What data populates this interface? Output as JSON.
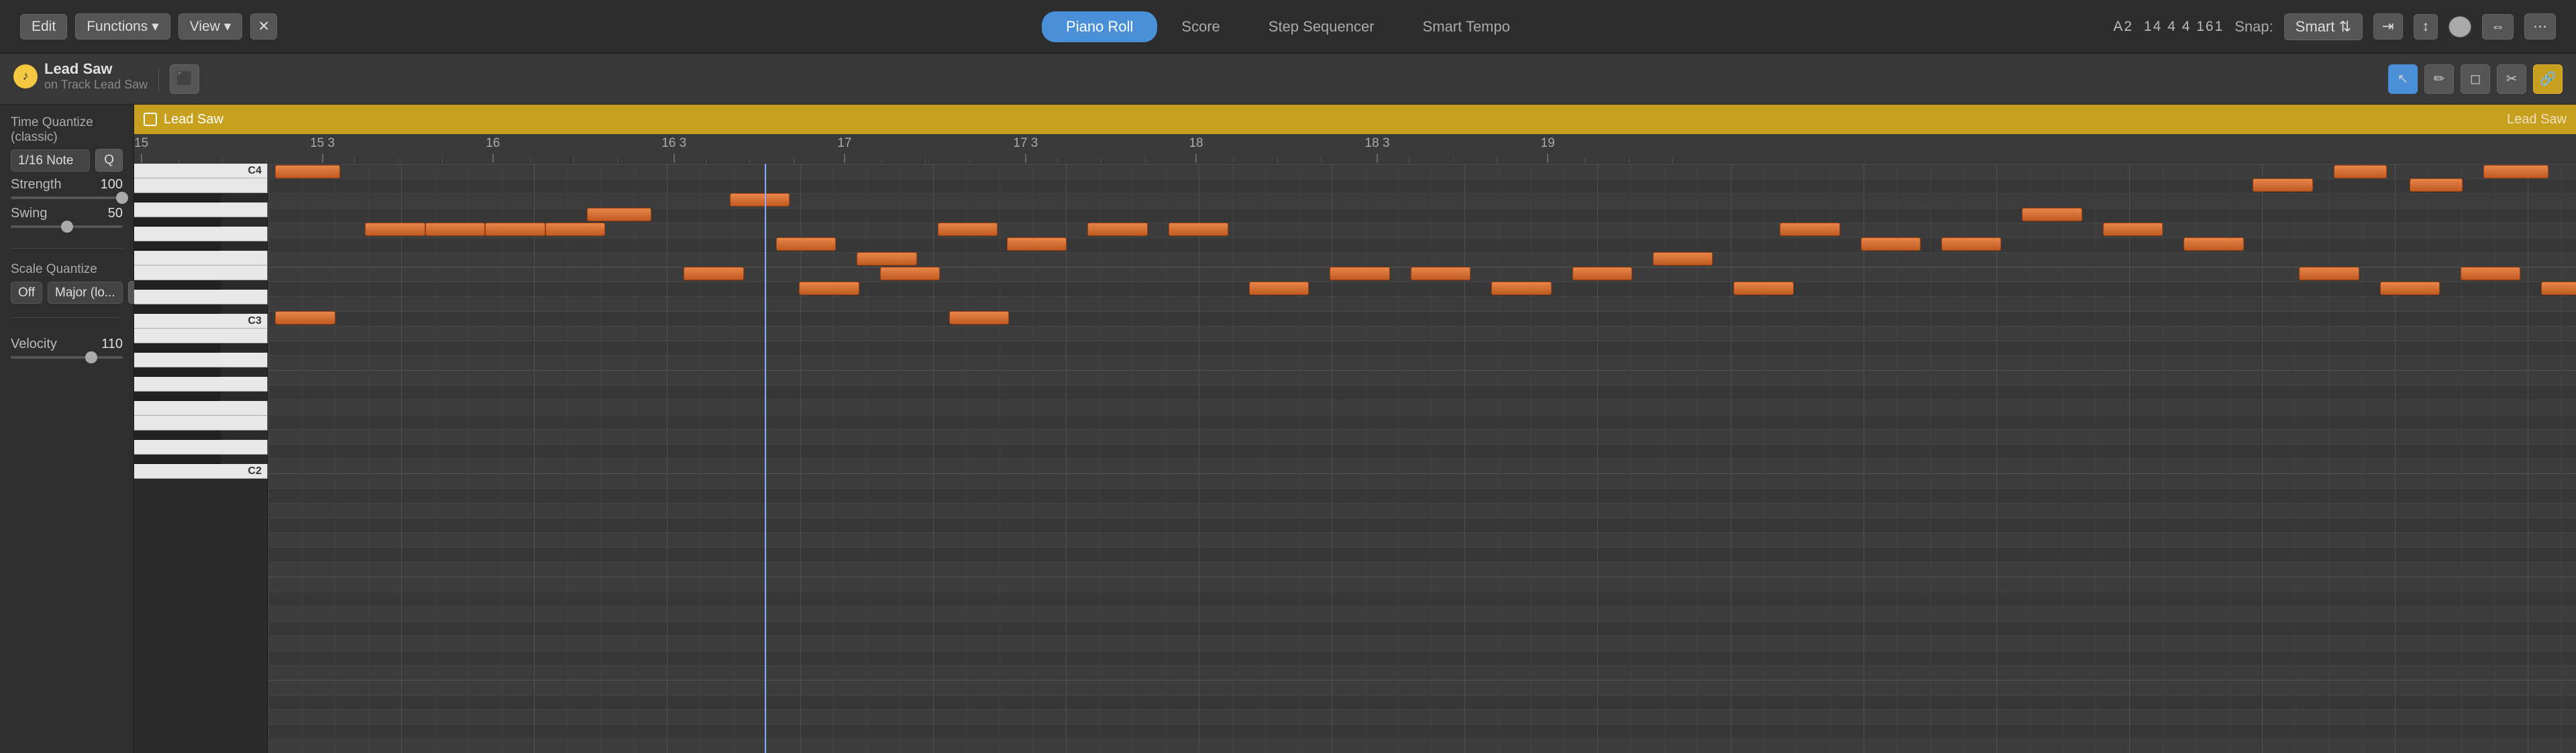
{
  "tabs": {
    "piano_roll": "Piano Roll",
    "score": "Score",
    "step_sequencer": "Step Sequencer",
    "smart_tempo": "Smart Tempo"
  },
  "top_bar": {
    "edit_label": "Edit",
    "functions_label": "Functions",
    "view_label": "View",
    "position": "A2",
    "time_sig": "14 4 4 161",
    "snap_label": "Snap:",
    "snap_value": "Smart"
  },
  "toolbar": {
    "tools": [
      "pencil",
      "cycle",
      "record",
      "trim",
      "link"
    ]
  },
  "track": {
    "name": "Lead Saw",
    "sub": "on Track Lead Saw"
  },
  "time_quantize": {
    "label": "Time Quantize (classic)",
    "note_value": "1/16 Note",
    "strength_label": "Strength",
    "strength_value": "100",
    "strength_pct": 100,
    "swing_label": "Swing",
    "swing_value": "50",
    "swing_pct": 50
  },
  "scale_quantize": {
    "label": "Scale Quantize",
    "off_label": "Off",
    "scale_label": "Major (lo...",
    "q_label": "Q"
  },
  "velocity": {
    "label": "Velocity",
    "value": "110",
    "pct": 72
  },
  "ruler": {
    "marks": [
      {
        "label": "15",
        "pos_pct": 0
      },
      {
        "label": "15 3",
        "pos_pct": 7.2
      },
      {
        "label": "16",
        "pos_pct": 14.4
      },
      {
        "label": "16 3",
        "pos_pct": 21.6
      },
      {
        "label": "17",
        "pos_pct": 28.8
      },
      {
        "label": "17 3",
        "pos_pct": 36
      },
      {
        "label": "18",
        "pos_pct": 43.2
      },
      {
        "label": "18 3",
        "pos_pct": 50.4
      },
      {
        "label": "19",
        "pos_pct": 57.6
      }
    ]
  },
  "region_label": "Lead Saw",
  "notes": [
    {
      "row": 14,
      "left_pct": 0.5,
      "width_pct": 3.2
    },
    {
      "row": 16,
      "left_pct": 4.5,
      "width_pct": 2.8
    },
    {
      "row": 16,
      "left_pct": 7.2,
      "width_pct": 2.8
    },
    {
      "row": 16,
      "left_pct": 9.8,
      "width_pct": 2.8
    },
    {
      "row": 16,
      "left_pct": 12.4,
      "width_pct": 2.8
    },
    {
      "row": 14,
      "left_pct": 14.2,
      "width_pct": 3.0
    },
    {
      "row": 15,
      "left_pct": 18.0,
      "width_pct": 2.8
    },
    {
      "row": 16,
      "left_pct": 21.5,
      "width_pct": 2.8
    },
    {
      "row": 15,
      "left_pct": 25.2,
      "width_pct": 2.8
    },
    {
      "row": 19,
      "left_pct": 9.5,
      "width_pct": 2.5
    },
    {
      "row": 14,
      "left_pct": 28.8,
      "width_pct": 2.8
    },
    {
      "row": 16,
      "left_pct": 32.5,
      "width_pct": 2.8
    },
    {
      "row": 15,
      "left_pct": 36.2,
      "width_pct": 2.8
    },
    {
      "row": 16,
      "left_pct": 39.8,
      "width_pct": 2.8
    },
    {
      "row": 14,
      "left_pct": 43.5,
      "width_pct": 2.8
    },
    {
      "row": 16,
      "left_pct": 47.2,
      "width_pct": 2.8
    },
    {
      "row": 15,
      "left_pct": 50.8,
      "width_pct": 2.8
    },
    {
      "row": 19,
      "left_pct": 43.0,
      "width_pct": 2.5
    },
    {
      "row": 22,
      "left_pct": 50.0,
      "width_pct": 2.5
    },
    {
      "row": 21,
      "left_pct": 55.5,
      "width_pct": 2.8
    },
    {
      "row": 19,
      "left_pct": 59.0,
      "width_pct": 2.5
    },
    {
      "row": 19,
      "left_pct": 62.5,
      "width_pct": 2.8
    },
    {
      "row": 22,
      "left_pct": 65.5,
      "width_pct": 2.5
    },
    {
      "row": 22,
      "left_pct": 71.5,
      "width_pct": 2.5
    },
    {
      "row": 22,
      "left_pct": 78.0,
      "width_pct": 2.5
    },
    {
      "row": 22,
      "left_pct": 85.0,
      "width_pct": 2.5
    },
    {
      "row": 21,
      "left_pct": 88.5,
      "width_pct": 2.5
    },
    {
      "row": 19,
      "left_pct": 92.0,
      "width_pct": 2.5
    },
    {
      "row": 14,
      "left_pct": 57.5,
      "width_pct": 2.8
    },
    {
      "row": 15,
      "left_pct": 60.5,
      "width_pct": 2.8
    },
    {
      "row": 16,
      "left_pct": 64.2,
      "width_pct": 2.8
    },
    {
      "row": 14,
      "left_pct": 68.0,
      "width_pct": 2.8
    },
    {
      "row": 15,
      "left_pct": 71.8,
      "width_pct": 2.8
    },
    {
      "row": 14,
      "left_pct": 75.5,
      "width_pct": 2.8
    },
    {
      "row": 16,
      "left_pct": 79.2,
      "width_pct": 2.8
    },
    {
      "row": 16,
      "left_pct": 82.8,
      "width_pct": 2.8
    },
    {
      "row": 15,
      "left_pct": 86.5,
      "width_pct": 2.8
    },
    {
      "row": 22,
      "left_pct": 96.0,
      "width_pct": 3.0
    },
    {
      "row": 24,
      "left_pct": 89.5,
      "width_pct": 2.5
    },
    {
      "row": 24,
      "left_pct": 96.8,
      "width_pct": 2.5
    },
    {
      "row": 22,
      "left_pct": 91.0,
      "width_pct": 2.5
    }
  ],
  "piano_keys": [
    {
      "note": "C4",
      "type": "white",
      "label": "C4"
    },
    {
      "note": "B3",
      "type": "white"
    },
    {
      "note": "Bb3",
      "type": "black"
    },
    {
      "note": "A3",
      "type": "white"
    },
    {
      "note": "Ab3",
      "type": "black"
    },
    {
      "note": "G3",
      "type": "white"
    },
    {
      "note": "Gb3",
      "type": "black"
    },
    {
      "note": "F3",
      "type": "white"
    },
    {
      "note": "E3",
      "type": "white"
    },
    {
      "note": "Eb3",
      "type": "black"
    },
    {
      "note": "D3",
      "type": "white"
    },
    {
      "note": "Db3",
      "type": "black"
    },
    {
      "note": "C3",
      "type": "white",
      "label": "C3"
    },
    {
      "note": "B2",
      "type": "white"
    },
    {
      "note": "Bb2",
      "type": "black"
    },
    {
      "note": "A2",
      "type": "white"
    },
    {
      "note": "Ab2",
      "type": "black"
    },
    {
      "note": "G2",
      "type": "white"
    },
    {
      "note": "Gb2",
      "type": "black"
    },
    {
      "note": "F2",
      "type": "white"
    },
    {
      "note": "E2",
      "type": "white"
    },
    {
      "note": "Eb2",
      "type": "black"
    },
    {
      "note": "D2",
      "type": "white"
    },
    {
      "note": "Db2",
      "type": "black"
    },
    {
      "note": "C2",
      "type": "white",
      "label": "C2"
    }
  ]
}
